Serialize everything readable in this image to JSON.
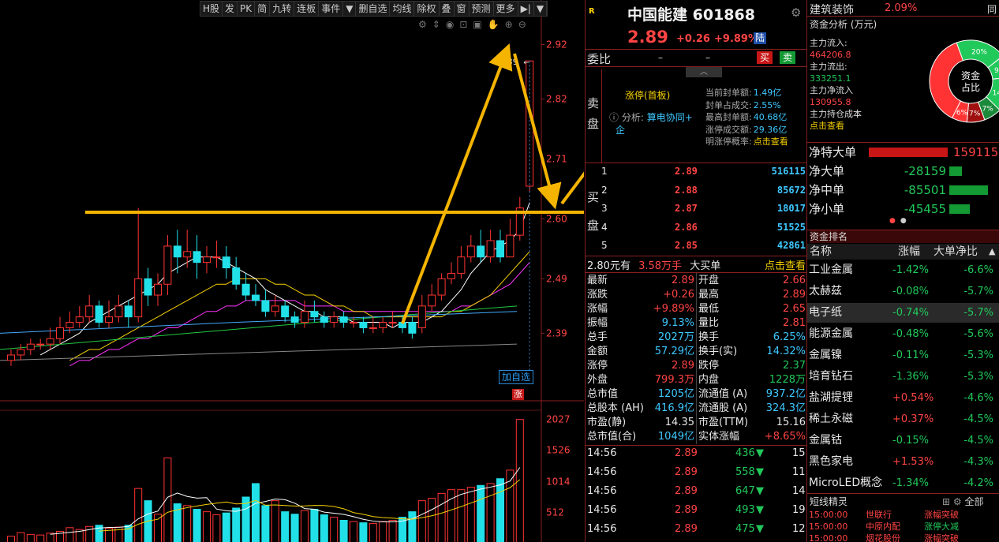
{
  "toolbar": {
    "items": [
      "H股",
      "发",
      "PK",
      "简",
      "九转",
      "连板",
      "事件",
      "▼",
      "删自选",
      "均线",
      "除权",
      "叠",
      "窗",
      "预测",
      "更多",
      "▶|",
      "▼"
    ]
  },
  "chart": {
    "price_ticks": [
      "2.92",
      "2.82",
      "2.71",
      "2.60",
      "2.49",
      "2.39"
    ],
    "vol_ticks": [
      "2027",
      "1526",
      "1014",
      "512"
    ],
    "high_label": "2.89",
    "add_watch": "加自选",
    "zhang": "涨",
    "colors": {
      "up": "#ff3333",
      "down": "#22e0e8",
      "ma5": "#ffffff",
      "ma10": "#f5d000",
      "ma20": "#ff33ff",
      "ma30": "#22cc44",
      "ma60": "#888888",
      "ma120": "#44aaff",
      "arrow": "#f5b400"
    }
  },
  "candles": [
    {
      "o": 2.34,
      "c": 2.35,
      "h": 2.36,
      "l": 2.33
    },
    {
      "o": 2.35,
      "c": 2.36,
      "h": 2.37,
      "l": 2.34
    },
    {
      "o": 2.36,
      "c": 2.37,
      "h": 2.38,
      "l": 2.35
    },
    {
      "o": 2.37,
      "c": 2.37,
      "h": 2.38,
      "l": 2.36
    },
    {
      "o": 2.37,
      "c": 2.38,
      "h": 2.4,
      "l": 2.36
    },
    {
      "o": 2.38,
      "c": 2.4,
      "h": 2.42,
      "l": 2.37
    },
    {
      "o": 2.4,
      "c": 2.41,
      "h": 2.43,
      "l": 2.39
    },
    {
      "o": 2.41,
      "c": 2.42,
      "h": 2.44,
      "l": 2.4
    },
    {
      "o": 2.42,
      "c": 2.44,
      "h": 2.46,
      "l": 2.41
    },
    {
      "o": 2.44,
      "c": 2.41,
      "h": 2.45,
      "l": 2.4
    },
    {
      "o": 2.41,
      "c": 2.42,
      "h": 2.45,
      "l": 2.4
    },
    {
      "o": 2.42,
      "c": 2.44,
      "h": 2.46,
      "l": 2.41
    },
    {
      "o": 2.44,
      "c": 2.42,
      "h": 2.45,
      "l": 2.4
    },
    {
      "o": 2.42,
      "c": 2.49,
      "h": 2.62,
      "l": 2.41
    },
    {
      "o": 2.49,
      "c": 2.46,
      "h": 2.51,
      "l": 2.44
    },
    {
      "o": 2.46,
      "c": 2.48,
      "h": 2.5,
      "l": 2.44
    },
    {
      "o": 2.48,
      "c": 2.55,
      "h": 2.57,
      "l": 2.46
    },
    {
      "o": 2.55,
      "c": 2.53,
      "h": 2.58,
      "l": 2.5
    },
    {
      "o": 2.53,
      "c": 2.54,
      "h": 2.58,
      "l": 2.51
    },
    {
      "o": 2.54,
      "c": 2.52,
      "h": 2.57,
      "l": 2.49
    },
    {
      "o": 2.52,
      "c": 2.53,
      "h": 2.55,
      "l": 2.5
    },
    {
      "o": 2.53,
      "c": 2.53,
      "h": 2.56,
      "l": 2.51
    },
    {
      "o": 2.53,
      "c": 2.51,
      "h": 2.55,
      "l": 2.49
    },
    {
      "o": 2.51,
      "c": 2.48,
      "h": 2.53,
      "l": 2.47
    },
    {
      "o": 2.48,
      "c": 2.46,
      "h": 2.5,
      "l": 2.45
    },
    {
      "o": 2.46,
      "c": 2.45,
      "h": 2.48,
      "l": 2.44
    },
    {
      "o": 2.45,
      "c": 2.43,
      "h": 2.47,
      "l": 2.42
    },
    {
      "o": 2.43,
      "c": 2.44,
      "h": 2.46,
      "l": 2.42
    },
    {
      "o": 2.44,
      "c": 2.42,
      "h": 2.45,
      "l": 2.41
    },
    {
      "o": 2.42,
      "c": 2.41,
      "h": 2.43,
      "l": 2.4
    },
    {
      "o": 2.41,
      "c": 2.43,
      "h": 2.45,
      "l": 2.4
    },
    {
      "o": 2.43,
      "c": 2.42,
      "h": 2.45,
      "l": 2.41
    },
    {
      "o": 2.42,
      "c": 2.41,
      "h": 2.43,
      "l": 2.4
    },
    {
      "o": 2.41,
      "c": 2.42,
      "h": 2.43,
      "l": 2.4
    },
    {
      "o": 2.42,
      "c": 2.41,
      "h": 2.43,
      "l": 2.4
    },
    {
      "o": 2.41,
      "c": 2.41,
      "h": 2.42,
      "l": 2.4
    },
    {
      "o": 2.41,
      "c": 2.4,
      "h": 2.42,
      "l": 2.39
    },
    {
      "o": 2.4,
      "c": 2.4,
      "h": 2.42,
      "l": 2.39
    },
    {
      "o": 2.4,
      "c": 2.41,
      "h": 2.42,
      "l": 2.39
    },
    {
      "o": 2.41,
      "c": 2.41,
      "h": 2.43,
      "l": 2.4
    },
    {
      "o": 2.41,
      "c": 2.4,
      "h": 2.42,
      "l": 2.39
    },
    {
      "o": 2.41,
      "c": 2.39,
      "h": 2.42,
      "l": 2.38
    },
    {
      "o": 2.4,
      "c": 2.44,
      "h": 2.46,
      "l": 2.39
    },
    {
      "o": 2.44,
      "c": 2.46,
      "h": 2.48,
      "l": 2.43
    },
    {
      "o": 2.46,
      "c": 2.49,
      "h": 2.5,
      "l": 2.45
    },
    {
      "o": 2.49,
      "c": 2.5,
      "h": 2.52,
      "l": 2.48
    },
    {
      "o": 2.5,
      "c": 2.53,
      "h": 2.55,
      "l": 2.49
    },
    {
      "o": 2.53,
      "c": 2.55,
      "h": 2.57,
      "l": 2.52
    },
    {
      "o": 2.55,
      "c": 2.53,
      "h": 2.58,
      "l": 2.52
    },
    {
      "o": 2.53,
      "c": 2.56,
      "h": 2.58,
      "l": 2.52
    },
    {
      "o": 2.56,
      "c": 2.53,
      "h": 2.58,
      "l": 2.52
    },
    {
      "o": 2.53,
      "c": 2.57,
      "h": 2.6,
      "l": 2.53
    },
    {
      "o": 2.57,
      "c": 2.62,
      "h": 2.64,
      "l": 2.56
    },
    {
      "o": 2.66,
      "c": 2.89,
      "h": 2.89,
      "l": 2.65
    }
  ],
  "volumes": [
    120,
    180,
    150,
    140,
    170,
    200,
    260,
    230,
    280,
    300,
    250,
    270,
    300,
    900,
    700,
    480,
    1400,
    650,
    620,
    560,
    520,
    470,
    500,
    580,
    760,
    980,
    620,
    700,
    520,
    480,
    540,
    560,
    470,
    430,
    380,
    360,
    340,
    330,
    360,
    380,
    430,
    520,
    700,
    740,
    820,
    880,
    880,
    920,
    950,
    980,
    1060,
    1200,
    2027
  ],
  "ma": {
    "ma5": [
      2.35,
      2.36,
      2.37,
      2.38,
      2.39,
      2.41,
      2.42,
      2.43,
      2.44,
      2.45,
      2.46,
      2.47,
      2.48,
      2.5,
      2.51,
      2.52,
      2.53,
      2.53,
      2.53,
      2.52,
      2.51,
      2.5,
      2.49,
      2.47,
      2.46,
      2.45,
      2.44,
      2.43,
      2.43,
      2.42,
      2.42,
      2.42,
      2.41,
      2.41,
      2.41,
      2.41,
      2.4,
      2.41,
      2.41,
      2.41,
      2.42,
      2.43,
      2.45,
      2.47,
      2.5,
      2.52,
      2.54,
      2.55,
      2.56,
      2.58,
      2.63
    ],
    "ma10": [
      2.34,
      2.35,
      2.36,
      2.36,
      2.37,
      2.38,
      2.39,
      2.4,
      2.41,
      2.42,
      2.43,
      2.44,
      2.45,
      2.46,
      2.47,
      2.48,
      2.48,
      2.49,
      2.49,
      2.49,
      2.49,
      2.48,
      2.48,
      2.47,
      2.46,
      2.46,
      2.45,
      2.44,
      2.44,
      2.43,
      2.43,
      2.42,
      2.42,
      2.42,
      2.42,
      2.42,
      2.42,
      2.42,
      2.42,
      2.43,
      2.43,
      2.44,
      2.45,
      2.46,
      2.48,
      2.5,
      2.52,
      2.54
    ],
    "ma20": [
      2.33,
      2.34,
      2.34,
      2.35,
      2.36,
      2.36,
      2.37,
      2.38,
      2.38,
      2.39,
      2.4,
      2.4,
      2.41,
      2.42,
      2.43,
      2.43,
      2.44,
      2.44,
      2.45,
      2.45,
      2.45,
      2.45,
      2.45,
      2.45,
      2.44,
      2.44,
      2.44,
      2.44,
      2.43,
      2.43,
      2.43,
      2.43,
      2.43,
      2.43,
      2.43,
      2.43,
      2.43,
      2.43,
      2.43,
      2.43,
      2.44,
      2.44,
      2.45,
      2.46,
      2.47,
      2.48,
      2.5,
      2.52
    ]
  },
  "header": {
    "r": "R",
    "name": "中国能建",
    "code": "601868",
    "price": "2.89",
    "change": "+0.26",
    "pct": "+9.89%",
    "market": "陆"
  },
  "weibi": {
    "label": "委比",
    "v1": "–",
    "v2": "–",
    "buy": "买",
    "sell": "卖"
  },
  "limit": {
    "side_sell": [
      "卖",
      "盘"
    ],
    "side_buy": [
      "买",
      "盘"
    ],
    "title": "涨停(首板)",
    "analysis": "分析:",
    "analysis_link": "算电协同+",
    "analysis_suffix": "企",
    "items": [
      {
        "k": "当前封单额:",
        "v": "1.49亿"
      },
      {
        "k": "封单占成交:",
        "v": "2.55%"
      },
      {
        "k": "最高封单额:",
        "v": "40.68亿"
      },
      {
        "k": "涨停成交额:",
        "v": "29.36亿"
      },
      {
        "k": "明涨停概率:",
        "v": "点击查看"
      }
    ]
  },
  "bids": [
    {
      "n": "1",
      "p": "2.89",
      "v": "516115"
    },
    {
      "n": "2",
      "p": "2.88",
      "v": "85672"
    },
    {
      "n": "3",
      "p": "2.87",
      "v": "18017"
    },
    {
      "n": "4",
      "p": "2.86",
      "v": "51525"
    },
    {
      "n": "5",
      "p": "2.85",
      "v": "42861"
    }
  ],
  "bigorder": {
    "price": "2.80元有",
    "amt": "3.58万手",
    "label": "大买单",
    "link": "点击查看"
  },
  "quotes": [
    {
      "k1": "最新",
      "v1": "2.89",
      "c1": "r",
      "k2": "开盘",
      "v2": "2.66",
      "c2": "r"
    },
    {
      "k1": "涨跌",
      "v1": "+0.26",
      "c1": "r",
      "k2": "最高",
      "v2": "2.89",
      "c2": "r"
    },
    {
      "k1": "涨幅",
      "v1": "+9.89%",
      "c1": "r",
      "k2": "最低",
      "v2": "2.65",
      "c2": "r"
    },
    {
      "k1": "振幅",
      "v1": "9.13%",
      "c1": "c",
      "k2": "量比",
      "v2": "2.81",
      "c2": "r"
    },
    {
      "k1": "总手",
      "v1": "2027万",
      "c1": "c",
      "k2": "换手",
      "v2": "6.25%",
      "c2": "c"
    },
    {
      "k1": "金额",
      "v1": "57.29亿",
      "c1": "c",
      "k2": "换手(实)",
      "v2": "14.32%",
      "c2": "c"
    },
    {
      "k1": "涨停",
      "v1": "2.89",
      "c1": "r",
      "k2": "跌停",
      "v2": "2.37",
      "c2": "g"
    },
    {
      "k1": "外盘",
      "v1": "799.3万",
      "c1": "r",
      "k2": "内盘",
      "v2": "1228万",
      "c2": "g"
    },
    {
      "k1": "总市值",
      "v1": "1205亿",
      "c1": "c",
      "k2": "流通值 (A)",
      "v2": "937.2亿",
      "c2": "c"
    },
    {
      "k1": "总股本 (AH)",
      "v1": "416.9亿",
      "c1": "c",
      "k2": "流通股 (A)",
      "v2": "324.3亿",
      "c2": "c"
    },
    {
      "k1": "市盈(静)",
      "v1": "14.35",
      "c1": "w",
      "k2": "市盈(TTM)",
      "v2": "15.16",
      "c2": "w"
    },
    {
      "k1": "总市值(合)",
      "v1": "1049亿",
      "c1": "c",
      "k2": "实体涨幅",
      "v2": "+8.65%",
      "c2": "r"
    }
  ],
  "ticks": [
    {
      "t": "14:56",
      "p": "2.89",
      "v": "436",
      "n": "15"
    },
    {
      "t": "14:56",
      "p": "2.89",
      "v": "558",
      "n": "11"
    },
    {
      "t": "14:56",
      "p": "2.89",
      "v": "647",
      "n": "14"
    },
    {
      "t": "14:56",
      "p": "2.89",
      "v": "493",
      "n": "19"
    },
    {
      "t": "14:56",
      "p": "2.89",
      "v": "475",
      "n": "12"
    }
  ],
  "sector": {
    "name": "建筑装饰",
    "pct": "2.09%",
    "more": "同"
  },
  "funds": {
    "title": "资金分析 (万元)",
    "inflow_k": "主力流入:",
    "inflow_v": "464206.8",
    "outflow_k": "主力流出:",
    "outflow_v": "333251.1",
    "net_k": "主力净流入",
    "net_v": "130955.8",
    "cost_k": "主力持仓成本",
    "cost_link": "点击查看",
    "donut_center": [
      "资金",
      "占比"
    ],
    "slices": [
      {
        "label": "20%",
        "v": 20,
        "color": "#21c95a"
      },
      {
        "label": "9%",
        "v": 9,
        "color": "#21c95a"
      },
      {
        "label": "14%",
        "v": 14,
        "color": "#21c95a"
      },
      {
        "label": "7%",
        "v": 7,
        "color": "#1a8a3a"
      },
      {
        "label": "7%",
        "v": 7,
        "color": "#a01010"
      },
      {
        "label": "6%",
        "v": 6,
        "color": "#ff3333"
      },
      {
        "label": "",
        "v": 37,
        "color": "#ff3333"
      }
    ]
  },
  "netflow": [
    {
      "k": "净特大单",
      "v": "159115",
      "c": "r",
      "w": 1.0
    },
    {
      "k": "净大单",
      "v": "-28159",
      "c": "g",
      "w": 0.18
    },
    {
      "k": "净中单",
      "v": "-85501",
      "c": "g",
      "w": 0.54
    },
    {
      "k": "净小单",
      "v": "-45455",
      "c": "g",
      "w": 0.29
    }
  ],
  "ranking": {
    "title": "资金排名",
    "h_name": "名称",
    "h_pct": "涨幅",
    "h_net": "大单净比",
    "rows": [
      {
        "n": "工业金属",
        "p": "-1.42%",
        "pc": "g",
        "v": "-6.6%"
      },
      {
        "n": "太赫兹",
        "p": "-0.08%",
        "pc": "g",
        "v": "-5.7%"
      },
      {
        "n": "电子纸",
        "p": "-0.74%",
        "pc": "g",
        "v": "-5.7%"
      },
      {
        "n": "能源金属",
        "p": "-0.48%",
        "pc": "g",
        "v": "-5.6%"
      },
      {
        "n": "金属镍",
        "p": "-0.11%",
        "pc": "g",
        "v": "-5.3%"
      },
      {
        "n": "培育钻石",
        "p": "-1.36%",
        "pc": "g",
        "v": "-5.3%"
      },
      {
        "n": "盐湖提锂",
        "p": "+0.54%",
        "pc": "r",
        "v": "-4.6%"
      },
      {
        "n": "稀土永磁",
        "p": "+0.37%",
        "pc": "r",
        "v": "-4.5%"
      },
      {
        "n": "金属钴",
        "p": "-0.15%",
        "pc": "g",
        "v": "-4.5%"
      },
      {
        "n": "黑色家电",
        "p": "+1.53%",
        "pc": "r",
        "v": "-4.3%"
      },
      {
        "n": "MicroLED概念",
        "p": "-1.34%",
        "pc": "g",
        "v": "-4.2%"
      }
    ]
  },
  "spirit": {
    "title": "短线精灵",
    "all": "全部",
    "rows": [
      {
        "t": "15:00:00",
        "n": "世联行",
        "e": "涨幅突破"
      },
      {
        "t": "15:00:00",
        "n": "中原内配",
        "e": "涨停大减"
      },
      {
        "t": "15:00:00",
        "n": "烟花股份",
        "e": "涨幅突破"
      }
    ]
  }
}
